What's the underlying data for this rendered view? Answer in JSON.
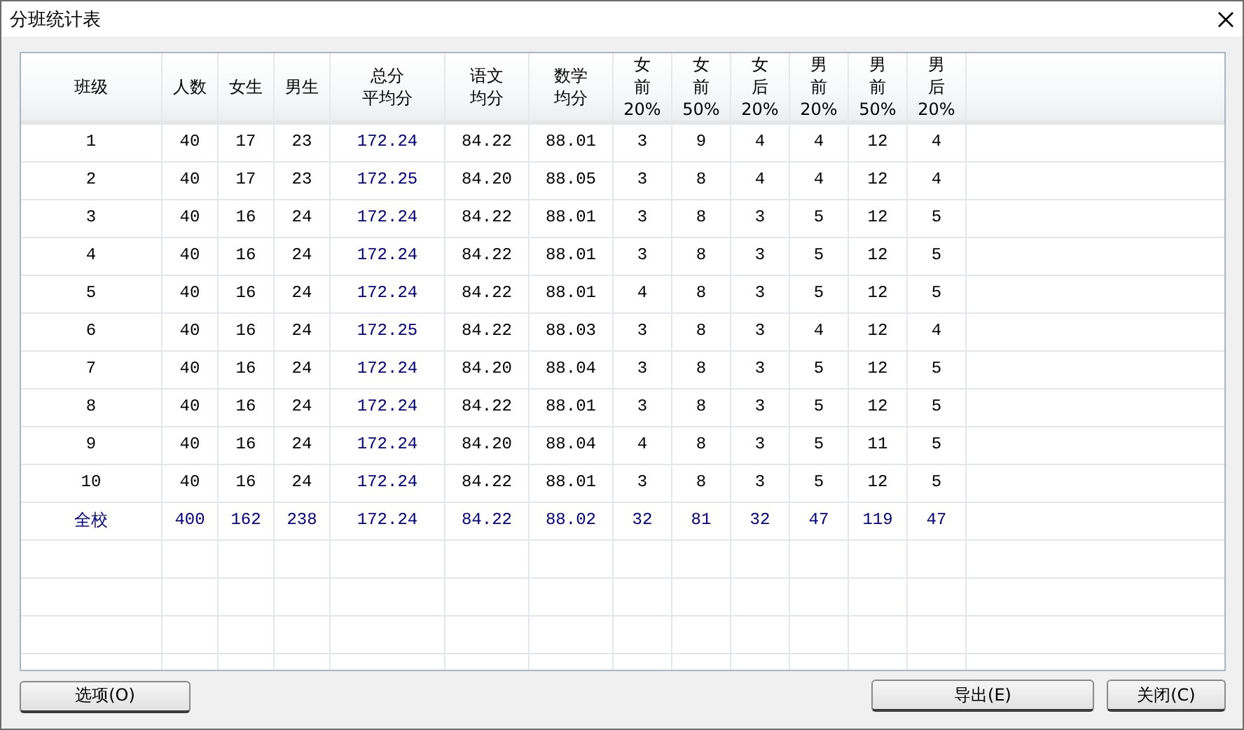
{
  "window": {
    "title": "分班统计表"
  },
  "table": {
    "columns": [
      {
        "lines": [
          "班级"
        ]
      },
      {
        "lines": [
          "人数"
        ]
      },
      {
        "lines": [
          "女生"
        ]
      },
      {
        "lines": [
          "男生"
        ]
      },
      {
        "lines": [
          "总分",
          "平均分"
        ]
      },
      {
        "lines": [
          "语文",
          "均分"
        ]
      },
      {
        "lines": [
          "数学",
          "均分"
        ]
      },
      {
        "lines": [
          "女",
          "前",
          "20%"
        ]
      },
      {
        "lines": [
          "女",
          "前",
          "50%"
        ]
      },
      {
        "lines": [
          "女",
          "后",
          "20%"
        ]
      },
      {
        "lines": [
          "男",
          "前",
          "20%"
        ]
      },
      {
        "lines": [
          "男",
          "前",
          "50%"
        ]
      },
      {
        "lines": [
          "男",
          "后",
          "20%"
        ]
      }
    ],
    "rows": [
      {
        "kind": "class",
        "cells": [
          "1",
          "40",
          "17",
          "23",
          "172.24",
          "84.22",
          "88.01",
          "3",
          "9",
          "4",
          "4",
          "12",
          "4"
        ]
      },
      {
        "kind": "class",
        "cells": [
          "2",
          "40",
          "17",
          "23",
          "172.25",
          "84.20",
          "88.05",
          "3",
          "8",
          "4",
          "4",
          "12",
          "4"
        ]
      },
      {
        "kind": "class",
        "cells": [
          "3",
          "40",
          "16",
          "24",
          "172.24",
          "84.22",
          "88.01",
          "3",
          "8",
          "3",
          "5",
          "12",
          "5"
        ]
      },
      {
        "kind": "class",
        "cells": [
          "4",
          "40",
          "16",
          "24",
          "172.24",
          "84.22",
          "88.01",
          "3",
          "8",
          "3",
          "5",
          "12",
          "5"
        ]
      },
      {
        "kind": "class",
        "cells": [
          "5",
          "40",
          "16",
          "24",
          "172.24",
          "84.22",
          "88.01",
          "4",
          "8",
          "3",
          "5",
          "12",
          "5"
        ]
      },
      {
        "kind": "class",
        "cells": [
          "6",
          "40",
          "16",
          "24",
          "172.25",
          "84.22",
          "88.03",
          "3",
          "8",
          "3",
          "4",
          "12",
          "4"
        ]
      },
      {
        "kind": "class",
        "cells": [
          "7",
          "40",
          "16",
          "24",
          "172.24",
          "84.20",
          "88.04",
          "3",
          "8",
          "3",
          "5",
          "12",
          "5"
        ]
      },
      {
        "kind": "class",
        "cells": [
          "8",
          "40",
          "16",
          "24",
          "172.24",
          "84.22",
          "88.01",
          "3",
          "8",
          "3",
          "5",
          "12",
          "5"
        ]
      },
      {
        "kind": "class",
        "cells": [
          "9",
          "40",
          "16",
          "24",
          "172.24",
          "84.20",
          "88.04",
          "4",
          "8",
          "3",
          "5",
          "11",
          "5"
        ]
      },
      {
        "kind": "class",
        "cells": [
          "10",
          "40",
          "16",
          "24",
          "172.24",
          "84.22",
          "88.01",
          "3",
          "8",
          "3",
          "5",
          "12",
          "5"
        ]
      },
      {
        "kind": "total",
        "cells": [
          "全校",
          "400",
          "162",
          "238",
          "172.24",
          "84.22",
          "88.02",
          "32",
          "81",
          "32",
          "47",
          "119",
          "47"
        ]
      }
    ]
  },
  "buttons_left": [
    "选项(O)"
  ],
  "buttons_right": [
    "导出(E)",
    "关闭(C)"
  ]
}
